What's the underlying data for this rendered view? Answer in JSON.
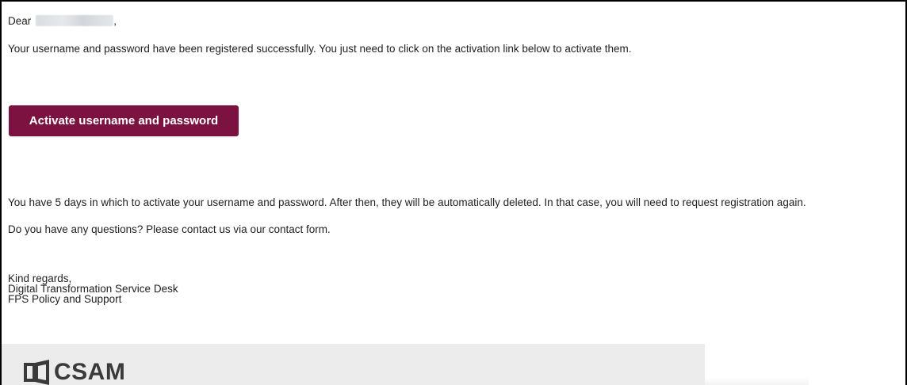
{
  "email": {
    "greeting_prefix": "Dear",
    "greeting_suffix": ",",
    "paragraph_1": "Your username and password have been registered successfully. You just need to click on the activation link below to activate them.",
    "activate_button_label": "Activate username and password",
    "paragraph_2": "You have 5 days in which to activate your username and password. After then, they will be automatically deleted. In that case, you will need to request registration again.",
    "paragraph_3": "Do you have any questions? Please contact us via our contact form.",
    "signature": {
      "line_1": "Kind regards,",
      "line_2": "Digital Transformation Service Desk",
      "line_3": "FPS Policy and Support"
    },
    "footer": {
      "logo_text": "CSAM",
      "band_color": "#ececec"
    }
  },
  "colors": {
    "button_bg": "#7c1240",
    "button_text": "#ffffff",
    "body_text": "#222222",
    "logo_text": "#3a3a3a"
  },
  "icons": {
    "logo": "csam-logo-icon"
  }
}
